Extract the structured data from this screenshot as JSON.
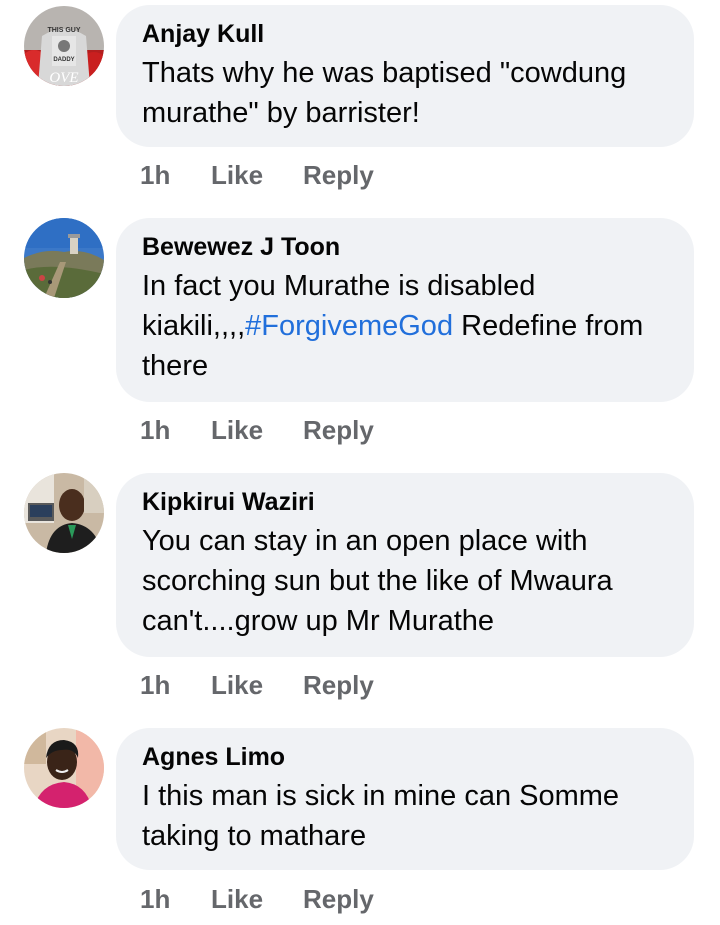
{
  "comments": [
    {
      "author": "Anjay Kull",
      "text": "Thats why he was baptised \"cowdung murathe\" by barrister!",
      "time": "1h",
      "like_label": "Like",
      "reply_label": "Reply",
      "avatar": {
        "shirt_text_top": "THIS GUY",
        "shirt_text_bottom": "DADDY",
        "overlay_text": "OVE"
      }
    },
    {
      "author": "Bewewez J Toon",
      "text_before": "In fact you Murathe is disabled kiakili,,,,",
      "hashtag": "#ForgivemeGod",
      "text_after": " Redefine from there",
      "time": "1h",
      "like_label": "Like",
      "reply_label": "Reply"
    },
    {
      "author": "Kipkirui Waziri",
      "text": "You can stay in an open place with scorching sun but the like of Mwaura can't....grow up Mr Murathe",
      "time": "1h",
      "like_label": "Like",
      "reply_label": "Reply"
    },
    {
      "author": "Agnes Limo",
      "text": "I this man is sick in mine can Somme taking to mathare",
      "time": "1h",
      "like_label": "Like",
      "reply_label": "Reply"
    }
  ],
  "colors": {
    "bubble": "#f0f2f5",
    "text": "#050505",
    "meta": "#65676b",
    "hashtag": "#216fdb"
  }
}
